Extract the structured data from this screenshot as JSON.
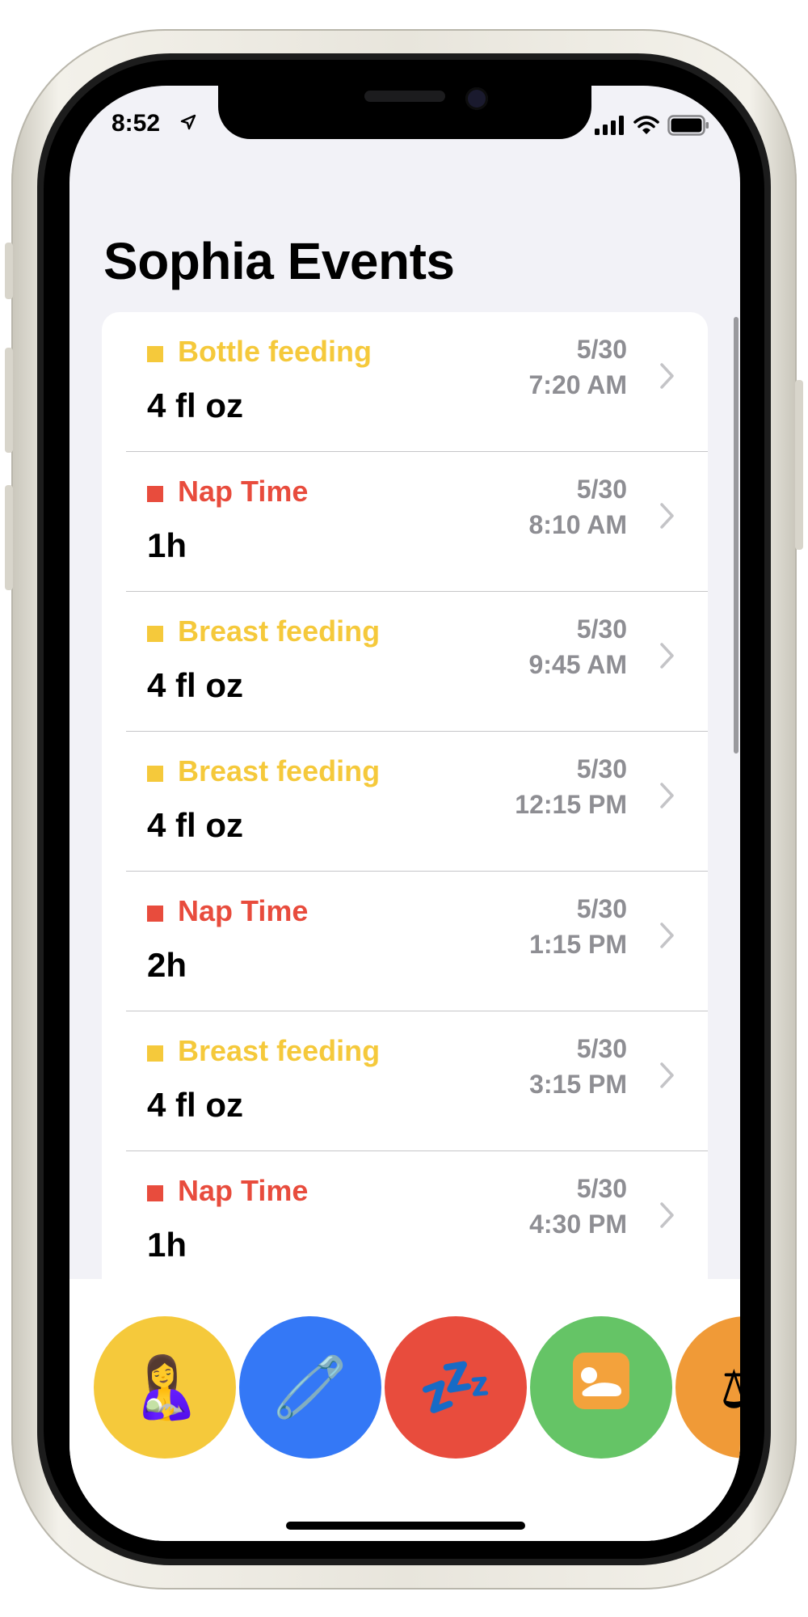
{
  "status_bar": {
    "time": "8:52"
  },
  "header": {
    "title": "Sophia Events"
  },
  "colors": {
    "feeding": "#f5c93b",
    "nap": "#e84c3d",
    "chevron": "#c4c4c7",
    "secondary_text": "#8e8e93"
  },
  "events": [
    {
      "type": "Bottle feeding",
      "value": "4 fl oz",
      "date": "5/30",
      "time": "7:20 AM",
      "color": "#f5c93b"
    },
    {
      "type": "Nap Time",
      "value": "1h",
      "date": "5/30",
      "time": "8:10 AM",
      "color": "#e84c3d"
    },
    {
      "type": "Breast feeding",
      "value": "4 fl oz",
      "date": "5/30",
      "time": "9:45 AM",
      "color": "#f5c93b"
    },
    {
      "type": "Breast feeding",
      "value": "4 fl oz",
      "date": "5/30",
      "time": "12:15 PM",
      "color": "#f5c93b"
    },
    {
      "type": "Nap Time",
      "value": "2h",
      "date": "5/30",
      "time": "1:15 PM",
      "color": "#e84c3d"
    },
    {
      "type": "Breast feeding",
      "value": "4 fl oz",
      "date": "5/30",
      "time": "3:15 PM",
      "color": "#f5c93b"
    },
    {
      "type": "Nap Time",
      "value": "1h",
      "date": "5/30",
      "time": "4:30 PM",
      "color": "#e84c3d"
    }
  ],
  "actions": [
    {
      "name": "feeding-action-button",
      "icon": "breastfeeding-emoji-icon",
      "glyph": "🤱",
      "color": "#f5c93b"
    },
    {
      "name": "diaper-action-button",
      "icon": "safety-pin-icon",
      "glyph": "🧷",
      "color": "#3478f6"
    },
    {
      "name": "sleep-action-button",
      "icon": "zzz-icon",
      "glyph": "💤",
      "color": "#e84c3d"
    },
    {
      "name": "tummy-time-action-button",
      "icon": "baby-lying-icon",
      "glyph": "",
      "color": "#65c466"
    },
    {
      "name": "weight-action-button",
      "icon": "scale-icon",
      "glyph": "⚖",
      "color": "#f09a37"
    }
  ]
}
